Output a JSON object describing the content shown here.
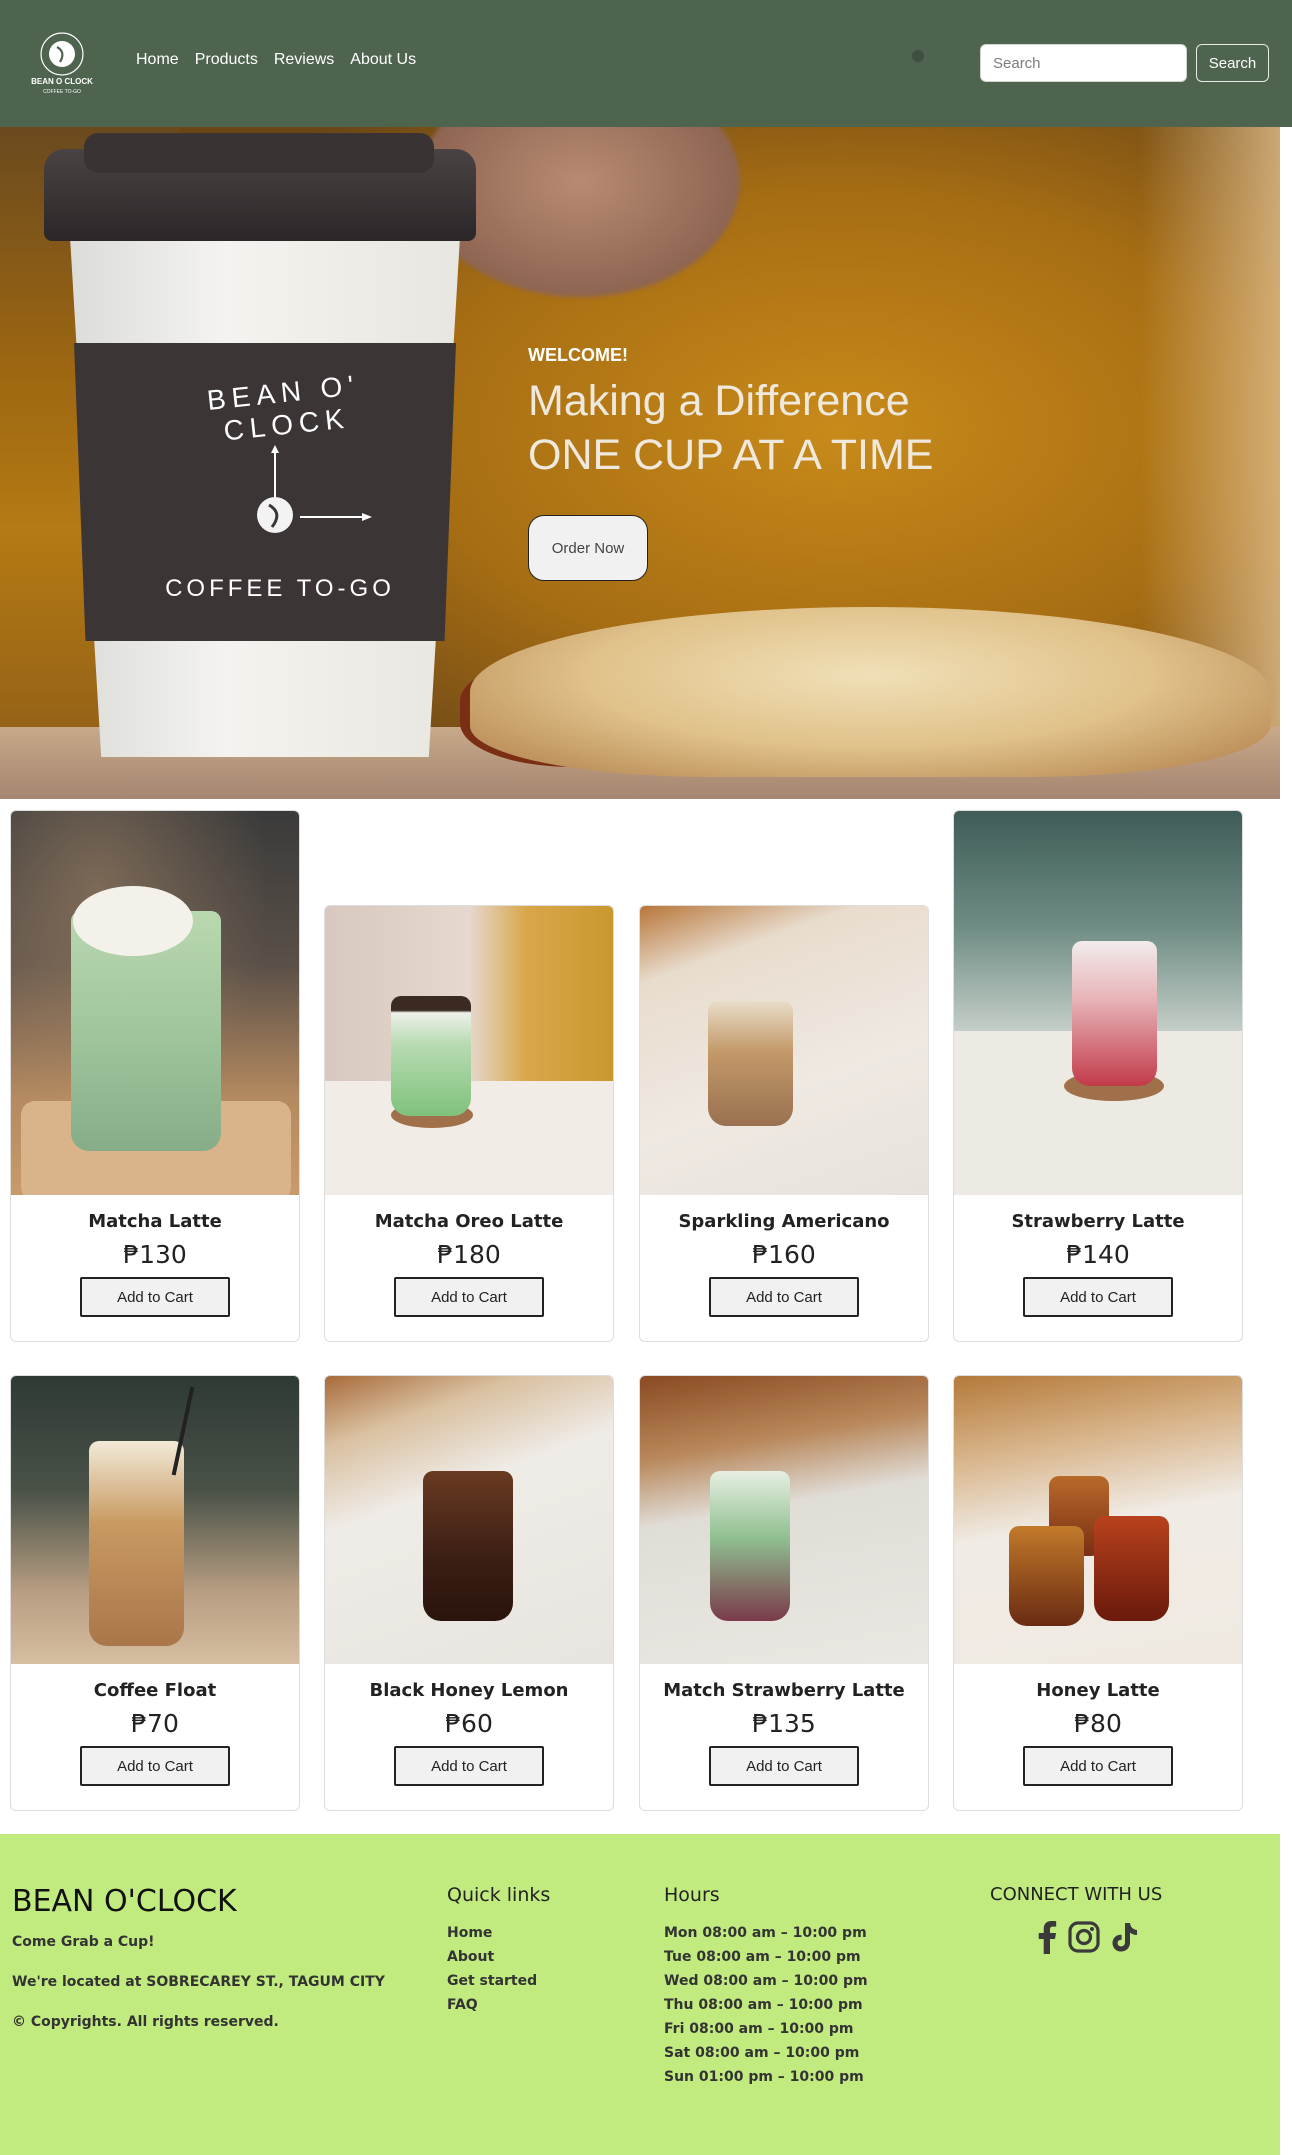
{
  "nav": {
    "logo_text_top": "BEAN O CLOCK",
    "logo_text_bottom": "COFFEE TO-GO",
    "links": [
      "Home",
      "Products",
      "Reviews",
      "About Us"
    ],
    "search_placeholder": "Search",
    "search_button": "Search"
  },
  "hero": {
    "welcome": "WELCOME!",
    "title_line1": "Making a Difference",
    "title_line2": "ONE CUP AT A TIME",
    "cta": "Order Now",
    "cup_brand": "BEAN O' CLOCK",
    "cup_tagline": "COFFEE TO-GO"
  },
  "products": [
    {
      "name": "Matcha Latte",
      "price": "₱130",
      "button": "Add to Cart"
    },
    {
      "name": "Matcha Oreo Latte",
      "price": "₱180",
      "button": "Add to Cart"
    },
    {
      "name": "Sparkling Americano",
      "price": "₱160",
      "button": "Add to Cart"
    },
    {
      "name": "Strawberry Latte",
      "price": "₱140",
      "button": "Add to Cart"
    },
    {
      "name": "Coffee Float",
      "price": "₱70",
      "button": "Add to Cart"
    },
    {
      "name": "Black Honey Lemon",
      "price": "₱60",
      "button": "Add to Cart"
    },
    {
      "name": "Match Strawberry Latte",
      "price": "₱135",
      "button": "Add to Cart"
    },
    {
      "name": "Honey Latte",
      "price": "₱80",
      "button": "Add to Cart"
    }
  ],
  "footer": {
    "brand": "BEAN O'CLOCK",
    "tagline": "Come Grab a Cup!",
    "location": "We're located at SOBRECAREY ST., TAGUM CITY",
    "copyright": "© Copyrights. All rights reserved.",
    "quick_links_title": "Quick links",
    "quick_links": [
      "Home",
      "About",
      "Get started",
      "FAQ"
    ],
    "hours_title": "Hours",
    "hours": [
      "Mon 08:00 am – 10:00 pm",
      "Tue 08:00 am – 10:00 pm",
      "Wed 08:00 am – 10:00 pm",
      "Thu 08:00 am – 10:00 pm",
      "Fri 08:00 am – 10:00 pm",
      "Sat 08:00 am – 10:00 pm",
      "Sun 01:00 pm – 10:00 pm"
    ],
    "connect_title": "CONNECT WITH US",
    "social_icons": [
      "facebook-icon",
      "instagram-icon",
      "tiktok-icon"
    ]
  },
  "colors": {
    "navbar": "#4e644f",
    "footer": "#c1eb7f"
  }
}
